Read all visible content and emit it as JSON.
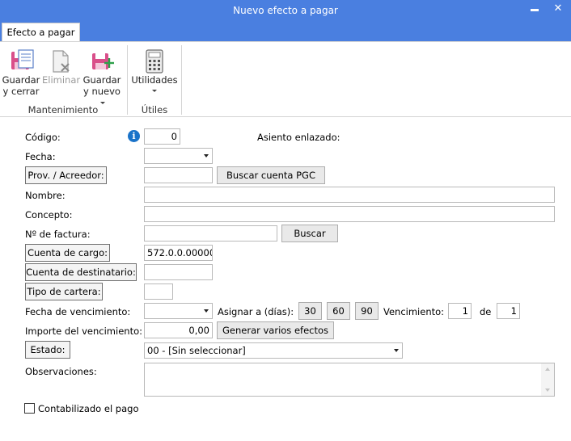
{
  "window": {
    "title": "Nuevo efecto a pagar",
    "minimize_glyph": "▬",
    "close_glyph": "✕"
  },
  "ribbon": {
    "tab": "Efecto a pagar",
    "groups": [
      {
        "label": "Mantenimiento"
      },
      {
        "label": "Útiles"
      }
    ],
    "buttons": {
      "save_close": {
        "line1": "Guardar",
        "line2": "y cerrar",
        "icon": "save-close-icon"
      },
      "delete": {
        "line1": "Eliminar",
        "icon": "delete-icon"
      },
      "save_new": {
        "line1": "Guardar",
        "line2": "y nuevo",
        "icon": "save-new-icon"
      },
      "utilities": {
        "line1": "Utilidades",
        "icon": "calculator-icon"
      }
    }
  },
  "form": {
    "codigo": {
      "label": "Código:",
      "value": "0"
    },
    "asiento": {
      "label": "Asiento enlazado:"
    },
    "fecha": {
      "label": "Fecha:",
      "value": ""
    },
    "prov": {
      "label": "Prov. / Acreedor:",
      "value": "",
      "search": "Buscar cuenta PGC"
    },
    "nombre": {
      "label": "Nombre:",
      "value": ""
    },
    "concepto": {
      "label": "Concepto:",
      "value": ""
    },
    "factura": {
      "label": "Nº de factura:",
      "value": "",
      "search": "Buscar"
    },
    "cargo": {
      "label": "Cuenta de cargo:",
      "value": "572.0.0.00000"
    },
    "destinatario": {
      "label": "Cuenta de destinatario:",
      "value": ""
    },
    "cartera": {
      "label": "Tipo de cartera:",
      "value": ""
    },
    "vencimiento": {
      "label": "Fecha de vencimiento:",
      "value": "",
      "assign_label": "Asignar a (días):",
      "days": [
        "30",
        "60",
        "90"
      ],
      "venc_label": "Vencimiento:",
      "venc_value": "1",
      "de_label": "de",
      "de_value": "1"
    },
    "importe": {
      "label": "Importe del vencimiento:",
      "value": "0,00",
      "generate": "Generar varios efectos"
    },
    "estado": {
      "label": "Estado:",
      "value": "00 - [Sin seleccionar]"
    },
    "observaciones": {
      "label": "Observaciones:",
      "value": ""
    },
    "contabilizado": {
      "label": "Contabilizado el pago",
      "checked": false
    }
  },
  "colors": {
    "titlebar": "#4a7fe0",
    "info": "#1a73c9"
  }
}
